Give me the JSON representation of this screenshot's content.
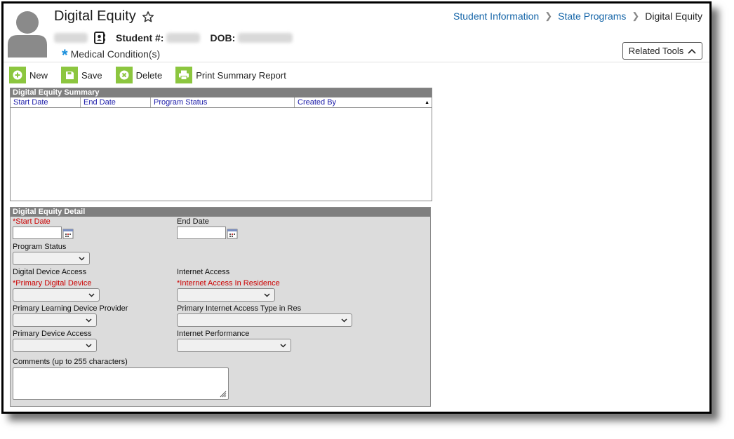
{
  "header": {
    "title": "Digital Equity",
    "student_label": "Student #:",
    "dob_label": "DOB:",
    "medical": "Medical Condition(s)"
  },
  "breadcrumb": {
    "items": [
      "Student Information",
      "State Programs"
    ],
    "current": "Digital Equity"
  },
  "related_tools": "Related Tools",
  "toolbar": {
    "new": "New",
    "save": "Save",
    "delete": "Delete",
    "print": "Print Summary Report"
  },
  "summary": {
    "title": "Digital Equity Summary",
    "columns": [
      "Start Date",
      "End Date",
      "Program Status",
      "Created By"
    ],
    "sort_indicator": "▲",
    "rows": []
  },
  "detail": {
    "title": "Digital Equity Detail",
    "start_date": "Start Date",
    "end_date": "End Date",
    "program_status": "Program Status",
    "digital_device_access": "Digital Device Access",
    "internet_access": "Internet Access",
    "primary_digital_device": "Primary Digital Device",
    "internet_access_residence": "Internet Access In Residence",
    "learning_device_provider": "Primary Learning Device Provider",
    "internet_access_type": "Primary Internet Access Type in Res",
    "primary_device_access": "Primary Device Access",
    "internet_performance": "Internet Performance",
    "comments": "Comments (up to 255 characters)",
    "required_marker": "*"
  },
  "colors": {
    "accent_green": "#8cc63f",
    "link_blue": "#1565a8",
    "required_red": "#cc0000",
    "panel_gray": "#7f7f7f"
  }
}
